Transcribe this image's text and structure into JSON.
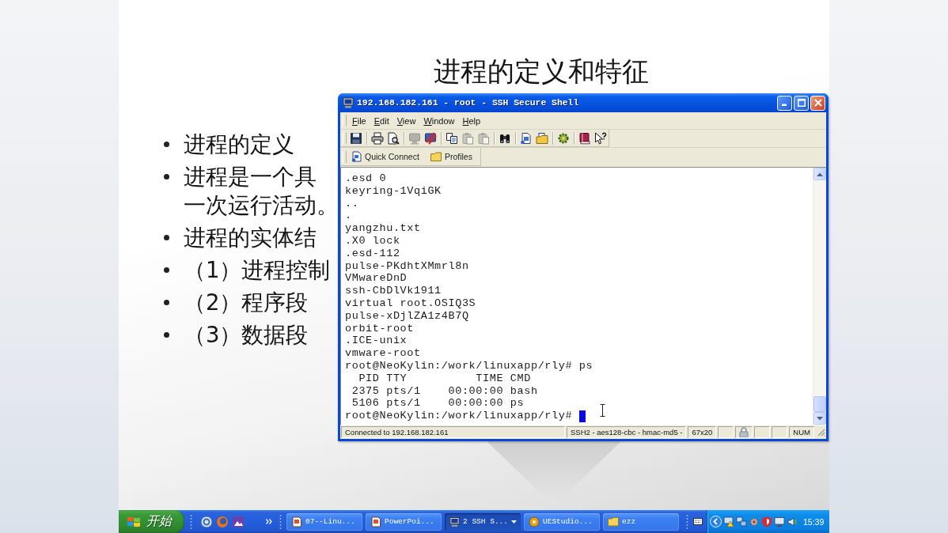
{
  "slide": {
    "title": "进程的定义和特征",
    "bullets": [
      {
        "lines": [
          "进程的定义"
        ]
      },
      {
        "lines": [
          "进程是一个具",
          "一次运行活动。"
        ]
      },
      {
        "lines": [
          "进程的实体结"
        ]
      },
      {
        "lines": [
          "（1）进程控制"
        ]
      },
      {
        "lines": [
          "（2）程序段"
        ]
      },
      {
        "lines": [
          "（3）数据段"
        ]
      }
    ]
  },
  "ssh_window": {
    "title": "192.168.182.161 - root - SSH Secure Shell",
    "menu": [
      "File",
      "Edit",
      "View",
      "Window",
      "Help"
    ],
    "toolbar": [
      [
        {
          "kind": "save",
          "disabled": false
        }
      ],
      [
        {
          "kind": "print",
          "disabled": false
        },
        {
          "kind": "print_preview",
          "disabled": false
        }
      ],
      [
        {
          "kind": "terminal",
          "disabled": true
        },
        {
          "kind": "disconnect",
          "disabled": false
        }
      ],
      [
        {
          "kind": "copy",
          "disabled": false
        },
        {
          "kind": "paste",
          "disabled": true
        },
        {
          "kind": "paste_file",
          "disabled": true
        }
      ],
      [
        {
          "kind": "find",
          "disabled": false
        }
      ],
      [
        {
          "kind": "new_terminal",
          "disabled": false
        },
        {
          "kind": "new_transfer",
          "disabled": false
        }
      ],
      [
        {
          "kind": "options",
          "disabled": false
        }
      ],
      [
        {
          "kind": "help",
          "disabled": false
        },
        {
          "kind": "context_help",
          "disabled": false
        }
      ]
    ],
    "quick_bar": [
      {
        "kind": "quick_connect",
        "label": "Quick Connect"
      },
      {
        "kind": "profiles",
        "label": "Profiles"
      }
    ],
    "terminal": {
      "lines": [
        ".esd 0",
        "keyring-1VqiGK",
        "..",
        ".",
        "yangzhu.txt",
        ".X0 lock",
        ".esd-112",
        "pulse-PKdhtXMmrl8n",
        "VMwareDnD",
        "ssh-CbDlVk1911",
        "virtual root.OSIQ3S",
        "pulse-xDjlZA1z4B7Q",
        "orbit-root",
        ".ICE-unix",
        "vmware-root",
        "root@NeoKylin:/work/linuxapp/rly# ps",
        "  PID TTY          TIME CMD",
        " 2375 pts/1    00:00:00 bash",
        " 5106 pts/1    00:00:00 ps",
        "root@NeoKylin:/work/linuxapp/rly#"
      ],
      "cursor": true
    },
    "status_bar": [
      {
        "kind": "text",
        "text": "Connected to 192.168.182.161"
      },
      {
        "kind": "text",
        "text": "SSH2 - aes128-cbc - hmac-md5 -"
      },
      {
        "kind": "text",
        "text": "67x20"
      },
      {
        "kind": "blank"
      },
      {
        "kind": "lock"
      },
      {
        "kind": "blank"
      },
      {
        "kind": "blank"
      },
      {
        "kind": "text",
        "text": "NUM"
      }
    ]
  },
  "taskbar": {
    "start_label": "开始",
    "tasks": [
      {
        "kind": "slides",
        "label": "07--Linu...",
        "selected": false,
        "grouped": false
      },
      {
        "kind": "slides",
        "label": "PowerPoi...",
        "selected": false,
        "grouped": false
      },
      {
        "kind": "terminal",
        "label": "2 SSH S...",
        "selected": true,
        "grouped": true
      },
      {
        "kind": "editor",
        "label": "UEStudio...",
        "selected": false,
        "grouped": false
      },
      {
        "kind": "folder",
        "label": "ezz",
        "selected": false,
        "grouped": false
      }
    ],
    "clock": "15:39"
  }
}
